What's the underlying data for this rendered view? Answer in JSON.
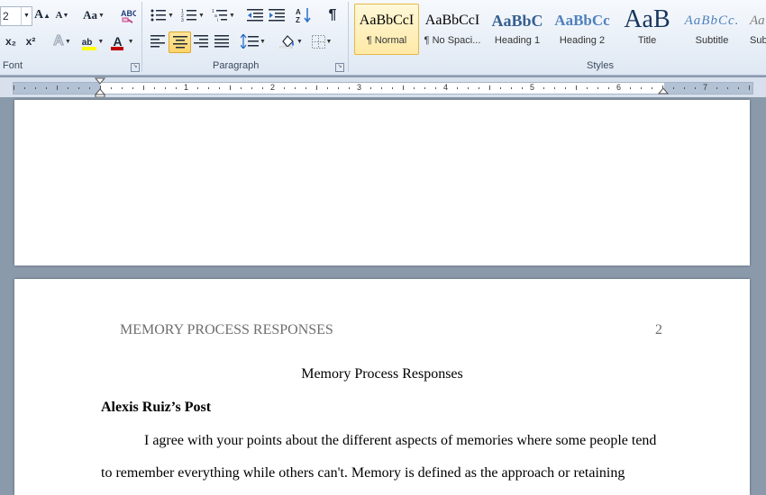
{
  "font_group": {
    "label": "Font",
    "size_value": "2",
    "grow_font": "A",
    "shrink_font": "A",
    "change_case": "Aa",
    "subscript": "x₂",
    "superscript": "x²",
    "text_effects": "A",
    "highlight": "ab",
    "font_color": "A"
  },
  "paragraph_group": {
    "label": "Paragraph",
    "pilcrow": "¶"
  },
  "styles_group": {
    "label": "Styles",
    "items": [
      {
        "sample": "AaBbCcI",
        "name": "¶ Normal"
      },
      {
        "sample": "AaBbCcI",
        "name": "¶ No Spaci..."
      },
      {
        "sample": "AaBbC",
        "name": "Heading 1"
      },
      {
        "sample": "AaBbCc",
        "name": "Heading 2"
      },
      {
        "sample": "AaB",
        "name": "Title"
      },
      {
        "sample": "AaBbCc.",
        "name": "Subtitle"
      },
      {
        "sample": "Aa",
        "name": "Sub"
      }
    ]
  },
  "ruler": {
    "numbers": [
      "1",
      "2",
      "3",
      "4",
      "5",
      "6",
      "7"
    ]
  },
  "document": {
    "running_head": "MEMORY PROCESS RESPONSES",
    "page_number": "2",
    "title": "Memory Process Responses",
    "section_heading": "Alexis Ruiz’s Post",
    "para_line1": "I agree with your points about the different aspects of memories  where some people tend",
    "para_line2": "to remember  everything while others can't. Memory  is  defined as the approach or retaining"
  },
  "colors": {
    "ribbon_bg": "#dfe8f3",
    "workspace_bg": "#8b9aab",
    "active_style": "#ffe9a6",
    "font_color_bar": "#c00000",
    "highlight_bar": "#ffff00"
  }
}
